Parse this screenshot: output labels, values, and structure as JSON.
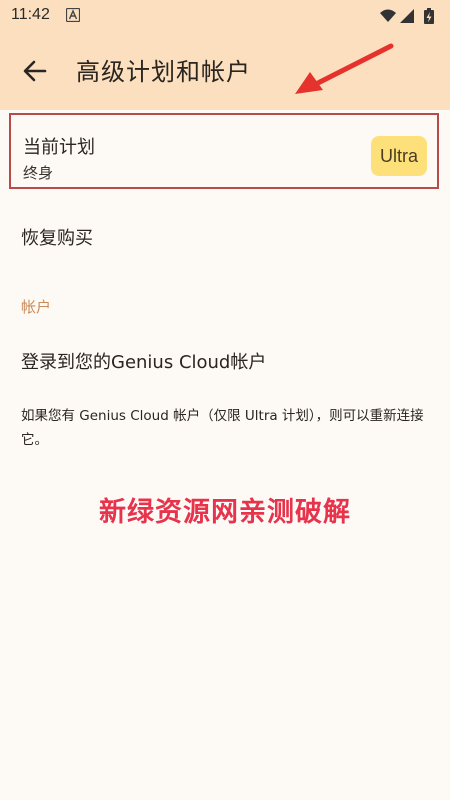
{
  "status_bar": {
    "time": "11:42",
    "notification_icon": "a-badge-icon",
    "icons": [
      "wifi-icon",
      "signal-icon",
      "battery-charging-icon"
    ]
  },
  "app_bar": {
    "back_icon": "arrow-left-icon",
    "title": "高级计划和帐户"
  },
  "current_plan": {
    "title": "当前计划",
    "subtitle": "终身",
    "badge": "Ultra"
  },
  "restore": {
    "label": "恢复购买"
  },
  "account_section": {
    "header": "帐户",
    "login_label": "登录到您的Genius Cloud帐户",
    "info": "如果您有 Genius Cloud 帐户（仅限 Ultra 计划），则可以重新连接它。"
  },
  "watermark": "新绿资源网亲测破解",
  "colors": {
    "header_bg": "#fbdfbf",
    "page_bg": "#fdf9f4",
    "badge_bg": "#fde07a",
    "section_header": "#c98a5a",
    "highlight_border": "#b94a4a",
    "watermark": "#e8344b"
  }
}
